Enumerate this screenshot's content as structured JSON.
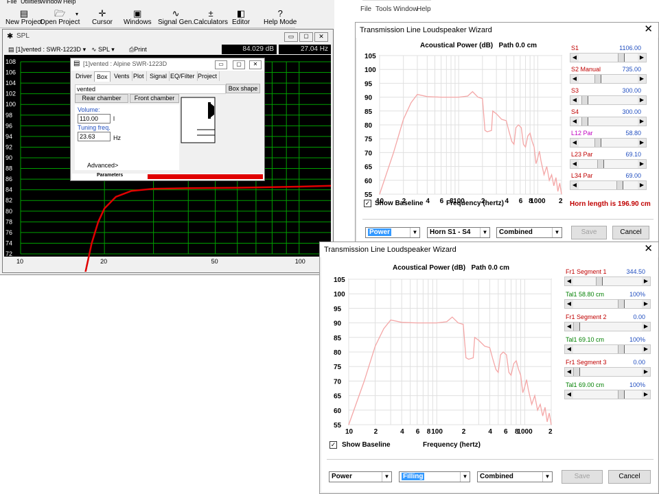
{
  "main_app": {
    "menu": [
      "File",
      "Utilities",
      "Window",
      "Help"
    ],
    "toolbar": [
      {
        "label": "New Project",
        "icon": "new-project-icon",
        "glyph": "▤"
      },
      {
        "label": "Open Project",
        "icon": "folder-icon",
        "glyph": "🗁"
      },
      {
        "label": "Cursor",
        "icon": "cursor-icon",
        "glyph": "✛"
      },
      {
        "label": "Windows",
        "icon": "windows-icon",
        "glyph": "▣"
      },
      {
        "label": "Signal Gen.",
        "icon": "sine-wave-icon",
        "glyph": "∿"
      },
      {
        "label": "Calculators",
        "icon": "calculator-icon",
        "glyph": "±"
      },
      {
        "label": "Editor",
        "icon": "editor-icon",
        "glyph": "◧"
      },
      {
        "label": "Help Mode",
        "icon": "help-icon",
        "glyph": "?"
      }
    ]
  },
  "spl_window": {
    "title": "SPL",
    "project_select": "[1]vented : SWR-1223D",
    "mode_select": "SPL",
    "print_label": "Print",
    "readout_db": "84.029 dB",
    "readout_hz": "27.04 Hz",
    "y_ticks": [
      "108",
      "106",
      "104",
      "102",
      "100",
      "98",
      "96",
      "94",
      "92",
      "90",
      "88",
      "86",
      "84",
      "82",
      "80",
      "78",
      "76",
      "74",
      "72"
    ],
    "x_ticks": [
      "10",
      "20",
      "50",
      "100"
    ],
    "curve_color": "#e00000",
    "grid_color": "#00a000"
  },
  "box_dialog": {
    "title": "[1]vented : Alpine SWR-1223D",
    "tabs": [
      "Driver",
      "Box",
      "Vents",
      "Plot",
      "Signal",
      "EQ/Filter",
      "Project"
    ],
    "box_type": "vented",
    "box_shape_label": "Box shape",
    "rear_chamber_label": "Rear chamber",
    "front_chamber_label": "Front chamber",
    "volume_label": "Volume:",
    "volume_value": "110.00",
    "volume_unit": "l",
    "tuning_label": "Tuning freq.",
    "tuning_value": "23.63",
    "tuning_unit": "Hz",
    "advanced_label": "Advanced>",
    "status_label": "Parameters"
  },
  "bg_window": {
    "menu": [
      "File",
      "Tools",
      "Window",
      "Help"
    ]
  },
  "wizard1": {
    "title": "Transmission Line Loudspeaker Wizard",
    "plot_title": "Acoustical Power (dB)   Path 0.0 cm",
    "show_baseline": "Show Baseline",
    "x_axis_label": "Frequency (hertz)",
    "sliders": [
      {
        "label": "S1",
        "value": "1106.00",
        "color": "#c00000",
        "pos": 0.75
      },
      {
        "label": "S2 Manual",
        "value": "735.00",
        "color": "#c00000",
        "pos": 0.3
      },
      {
        "label": "S3",
        "value": "300.00",
        "color": "#c00000",
        "pos": 0.05
      },
      {
        "label": "S4",
        "value": "300.00",
        "color": "#c00000",
        "pos": 0.05
      },
      {
        "label": "L12 Par",
        "value": "58.80",
        "color": "#c000c0",
        "pos": 0.3
      },
      {
        "label": "L23 Par",
        "value": "69.10",
        "color": "#c00000",
        "pos": 0.36
      },
      {
        "label": "L34 Par",
        "value": "69.00",
        "color": "#c00000",
        "pos": 0.73
      }
    ],
    "horn_length": "Horn length is 196.90 cm",
    "select_power": "Power",
    "select_horn": "Horn S1 - S4",
    "select_combined": "Combined",
    "save_label": "Save",
    "cancel_label": "Cancel"
  },
  "wizard2": {
    "title": "Transmission Line Loudspeaker Wizard",
    "plot_title": "Acoustical Power (dB)   Path 0.0 cm",
    "show_baseline": "Show Baseline",
    "x_axis_label": "Frequency (hertz)",
    "sliders": [
      {
        "label": "Fr1  Segment 1",
        "value": "344.50",
        "color": "#c00000",
        "pos": 0.37
      },
      {
        "label": "Tal1  58.80 cm",
        "value": "100%",
        "color": "#008000",
        "pos": 0.72
      },
      {
        "label": "Fr1  Segment 2",
        "value": "0.00",
        "color": "#c00000",
        "pos": 0.0
      },
      {
        "label": "Tal1  69.10 cm",
        "value": "100%",
        "color": "#008000",
        "pos": 0.72
      },
      {
        "label": "Fr1  Segment 3",
        "value": "0.00",
        "color": "#c00000",
        "pos": 0.0
      },
      {
        "label": "Tal1  69.00 cm",
        "value": "100%",
        "color": "#008000",
        "pos": 0.72
      }
    ],
    "select_power": "Power",
    "select_filling": "Filling",
    "select_combined": "Combined",
    "save_label": "Save",
    "cancel_label": "Cancel"
  },
  "power_plot": {
    "y_ticks": [
      "105",
      "100",
      "95",
      "90",
      "85",
      "80",
      "75",
      "70",
      "65",
      "60",
      "55"
    ],
    "x_ticks": [
      "10",
      "2",
      "4",
      "6",
      "8",
      "100",
      "2",
      "4",
      "6",
      "8",
      "1000",
      "2"
    ],
    "ylim": [
      55,
      105
    ],
    "xlim": [
      10,
      2000
    ],
    "curve_color": "#f4a6a6",
    "curve": [
      [
        10,
        55
      ],
      [
        15,
        70
      ],
      [
        20,
        82
      ],
      [
        25,
        88
      ],
      [
        30,
        91
      ],
      [
        40,
        90.2
      ],
      [
        60,
        90
      ],
      [
        100,
        90
      ],
      [
        130,
        90.4
      ],
      [
        150,
        92
      ],
      [
        175,
        90
      ],
      [
        200,
        89.5
      ],
      [
        215,
        78
      ],
      [
        230,
        77.5
      ],
      [
        260,
        78
      ],
      [
        270,
        85
      ],
      [
        300,
        84
      ],
      [
        350,
        82
      ],
      [
        400,
        81.5
      ],
      [
        430,
        78
      ],
      [
        470,
        74
      ],
      [
        500,
        73
      ],
      [
        530,
        79
      ],
      [
        570,
        80
      ],
      [
        620,
        79
      ],
      [
        660,
        73
      ],
      [
        700,
        72
      ],
      [
        750,
        76
      ],
      [
        800,
        77
      ],
      [
        850,
        74
      ],
      [
        900,
        72
      ],
      [
        950,
        66
      ],
      [
        1000,
        68
      ],
      [
        1050,
        70.5
      ],
      [
        1100,
        67
      ],
      [
        1200,
        62
      ],
      [
        1300,
        65
      ],
      [
        1400,
        60
      ],
      [
        1500,
        62
      ],
      [
        1600,
        58
      ],
      [
        1700,
        61
      ],
      [
        1800,
        56
      ],
      [
        1900,
        59
      ],
      [
        2000,
        55
      ]
    ]
  },
  "spl_curve": [
    [
      16,
      62
    ],
    [
      17,
      68
    ],
    [
      18,
      74
    ],
    [
      19,
      78
    ],
    [
      20,
      80.5
    ],
    [
      22,
      82.7
    ],
    [
      25,
      83.8
    ],
    [
      30,
      84.2
    ],
    [
      40,
      84.3
    ],
    [
      60,
      84.4
    ],
    [
      100,
      84.6
    ],
    [
      140,
      84.8
    ]
  ]
}
